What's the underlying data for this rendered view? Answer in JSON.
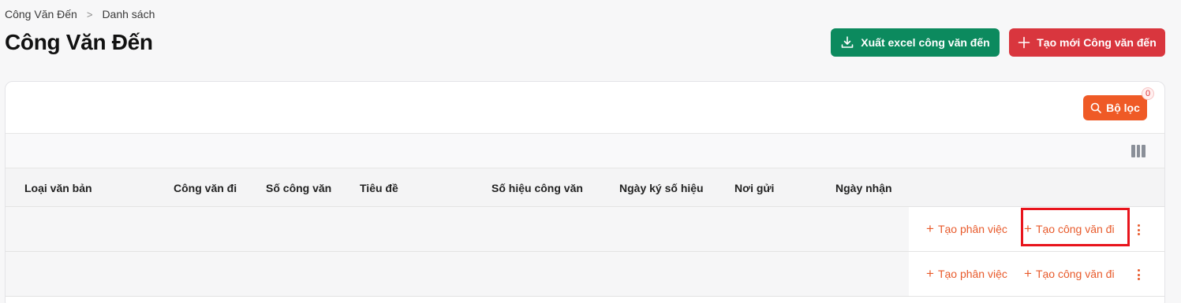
{
  "breadcrumb": {
    "home": "Công Văn Đến",
    "current": "Danh sách"
  },
  "page_title": "Công Văn Đến",
  "buttons": {
    "export": "Xuất excel công văn đến",
    "create": "Tạo mới Công văn đến",
    "filter": "Bộ lọc",
    "filter_count": "0"
  },
  "table": {
    "headers": [
      "Loại văn bản",
      "Công văn đi",
      "Số công văn",
      "Tiêu đề",
      "Số hiệu công văn",
      "Ngày ký số hiệu",
      "Nơi gửi",
      "Ngày nhận"
    ],
    "rows": [
      {
        "cells": [
          "",
          "",
          "",
          "",
          "",
          "",
          "",
          ""
        ],
        "actions": {
          "assign": "Tạo phân việc",
          "outgoing": "Tạo công văn đi"
        }
      },
      {
        "cells": [
          "",
          "",
          "",
          "",
          "",
          "",
          "",
          ""
        ],
        "actions": {
          "assign": "Tạo phân việc",
          "outgoing": "Tạo công văn đi"
        }
      }
    ]
  },
  "colors": {
    "export": "#0c8a5e",
    "create": "#d9363e",
    "filter": "#ef5a26",
    "action": "#e85a2b",
    "highlight": "#e8141c"
  }
}
